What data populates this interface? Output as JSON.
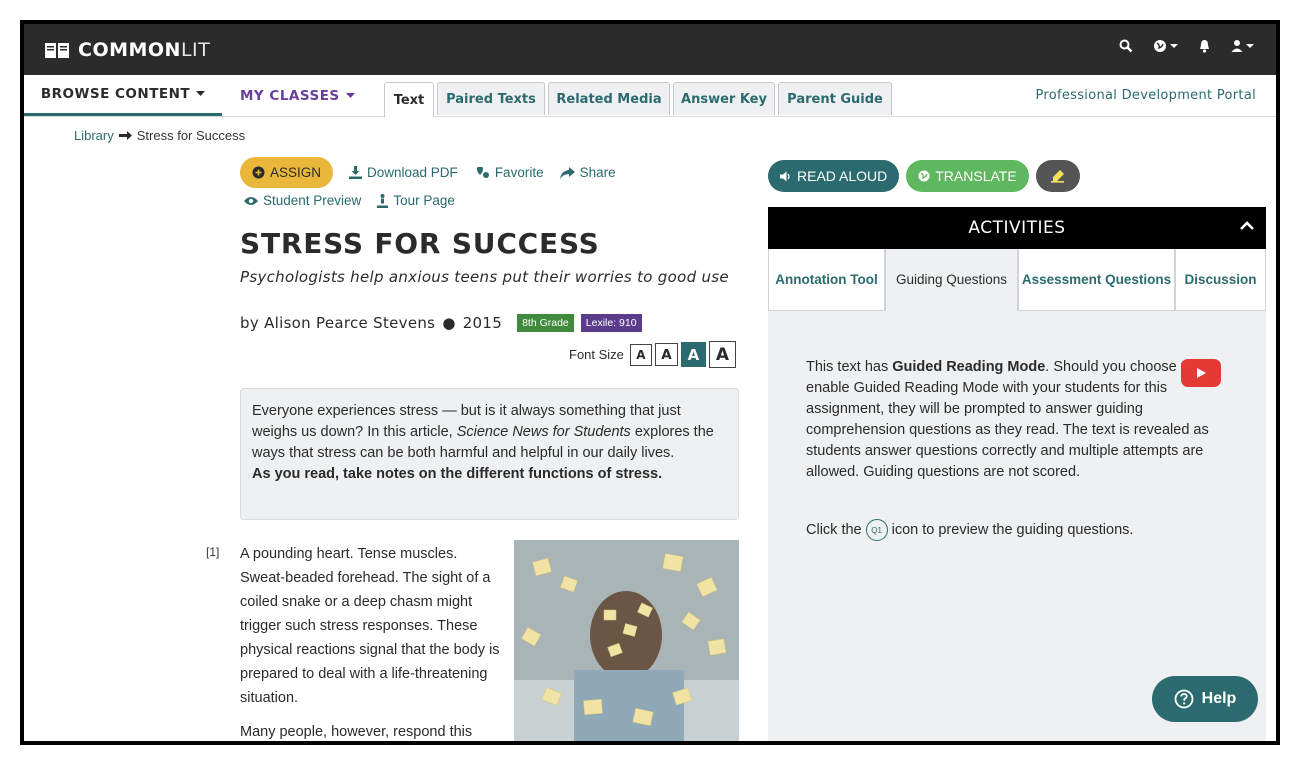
{
  "header": {
    "logo_bold": "COMMON",
    "logo_light": "LIT"
  },
  "nav": {
    "browse": "BROWSE CONTENT",
    "classes": "MY CLASSES",
    "tabs": [
      "Text",
      "Paired Texts",
      "Related Media",
      "Answer Key",
      "Parent Guide"
    ],
    "active_tab": "Text",
    "pd_link": "Professional Development Portal"
  },
  "breadcrumb": {
    "root": "Library",
    "current": "Stress for Success"
  },
  "actions": {
    "assign": "ASSIGN",
    "download": "Download PDF",
    "favorite": "Favorite",
    "share": "Share",
    "preview": "Student Preview",
    "tour": "Tour Page"
  },
  "article": {
    "title": "STRESS FOR SUCCESS",
    "subtitle": "Psychologists help anxious teens put their worries to good use",
    "author": "by Alison Pearce Stevens",
    "year": "2015",
    "grade": "8th Grade",
    "lexile": "Lexile: 910",
    "font_size_label": "Font Size",
    "intro_part1": "Everyone experiences stress — but is it always something that just weighs us down? In this article, ",
    "intro_source": "Science News for Students",
    "intro_part2": " explores the ways that stress can be both harmful and helpful in our daily lives.",
    "intro_strong": "As you read, take notes on the different functions of stress.",
    "para_num": "[1]",
    "para1": "A pounding heart. Tense muscles. Sweat-beaded forehead. The sight of a coiled snake or a deep chasm might trigger such stress responses. These physical reactions signal that the body is prepared to deal with a life-threatening situation.",
    "para2": "Many people, however, respond this"
  },
  "tools": {
    "read_aloud": "READ ALOUD",
    "translate": "TRANSLATE"
  },
  "activities": {
    "title": "ACTIVITIES",
    "tabs": [
      "Annotation Tool",
      "Guiding Questions",
      "Assessment Questions",
      "Discussion"
    ],
    "active_tab": "Guiding Questions",
    "text_a": "This text has ",
    "text_b": "Guided Reading Mode",
    "text_c": ". Should you choose to enable Guided Reading Mode with your students for this assignment, they will be prompted to answer guiding comprehension questions as they read. The text is revealed as students answer questions correctly and multiple attempts are allowed. Guiding questions are not scored.",
    "click_a": "Click the",
    "q1_label": "Q1",
    "click_b": "icon to preview the guiding questions."
  },
  "help": "Help",
  "colors": {
    "teal": "#2b6b6f",
    "purple": "#6a3e9c",
    "assign_yellow": "#e9b83a",
    "translate_green": "#5fb75f",
    "grade_green": "#3f8a3d",
    "lexile_purple": "#5b3c8c",
    "youtube_red": "#e53935"
  }
}
